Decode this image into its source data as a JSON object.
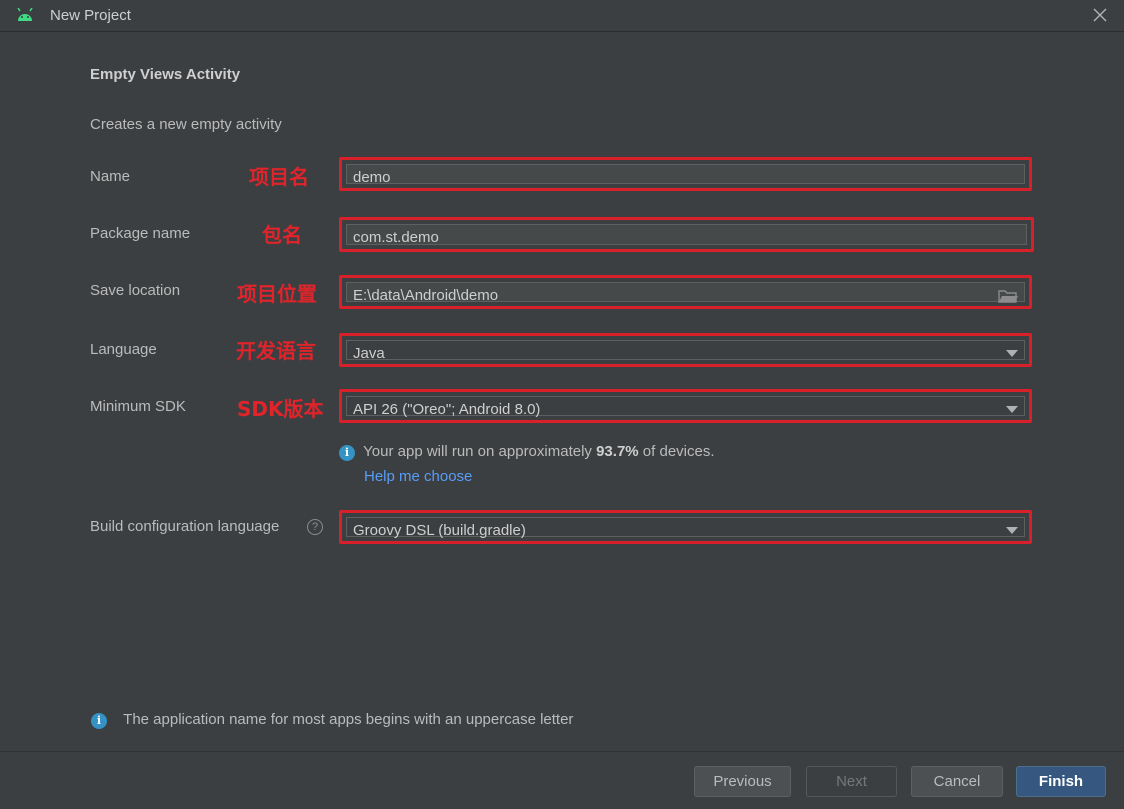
{
  "window": {
    "title": "New Project",
    "app_icon": "android-icon",
    "close_icon": "close-icon"
  },
  "form": {
    "heading": "Empty Views Activity",
    "description": "Creates a new empty activity",
    "name": {
      "label": "Name",
      "value": "demo",
      "annotation": "项目名"
    },
    "package": {
      "label": "Package name",
      "value": "com.st.demo",
      "annotation": "包名"
    },
    "save_location": {
      "label": "Save location",
      "value": "E:\\data\\Android\\demo",
      "annotation": "项目位置",
      "icon": "folder-icon"
    },
    "language": {
      "label": "Language",
      "value": "Java",
      "annotation": "开发语言"
    },
    "min_sdk": {
      "label": "Minimum SDK",
      "value": "API 26 (\"Oreo\"; Android 8.0)",
      "annotation": "SDK版本"
    },
    "sdk_info": {
      "prefix": "Your app will run on approximately ",
      "percent": "93.7%",
      "suffix": " of devices."
    },
    "help_link": "Help me choose",
    "build_config": {
      "label": "Build configuration language",
      "value": "Groovy DSL (build.gradle)"
    }
  },
  "bottom_info": "The application name for most apps begins with an uppercase letter",
  "buttons": {
    "previous": "Previous",
    "next": "Next",
    "cancel": "Cancel",
    "finish": "Finish"
  },
  "colors": {
    "background": "#3c3f41",
    "annotation_red": "#e0242b",
    "link_blue": "#589df6",
    "primary_button": "#365880"
  }
}
